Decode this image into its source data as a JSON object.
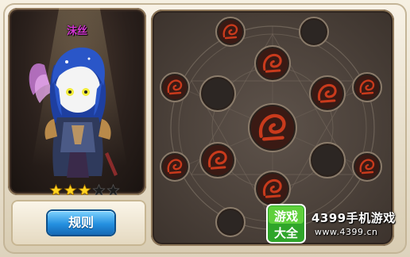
{
  "character": {
    "name": "沫丝",
    "stars_filled": 3,
    "stars_total": 5,
    "name_color": "#d436d2"
  },
  "rules_button": {
    "label": "规则",
    "color": "#2490df"
  },
  "rune_board": {
    "slots": [
      {
        "id": "outer-top",
        "state": "filled"
      },
      {
        "id": "outer-top-right",
        "state": "empty"
      },
      {
        "id": "outer-left-upper",
        "state": "filled"
      },
      {
        "id": "outer-right-upper",
        "state": "filled"
      },
      {
        "id": "outer-left-lower",
        "state": "filled"
      },
      {
        "id": "outer-right-lower",
        "state": "filled"
      },
      {
        "id": "outer-bottom",
        "state": "empty"
      },
      {
        "id": "inner-top",
        "state": "filled"
      },
      {
        "id": "inner-upper-left",
        "state": "empty"
      },
      {
        "id": "inner-upper-right",
        "state": "filled"
      },
      {
        "id": "inner-lower-left",
        "state": "filled"
      },
      {
        "id": "inner-lower-right",
        "state": "empty"
      },
      {
        "id": "inner-bottom",
        "state": "filled"
      },
      {
        "id": "center",
        "state": "filled"
      }
    ],
    "rune_color": "#c93a1c"
  },
  "watermark": {
    "logo_top": "游戏",
    "logo_bottom": "大全",
    "brand": "4399手机游戏",
    "url": "www.4399.cn"
  }
}
